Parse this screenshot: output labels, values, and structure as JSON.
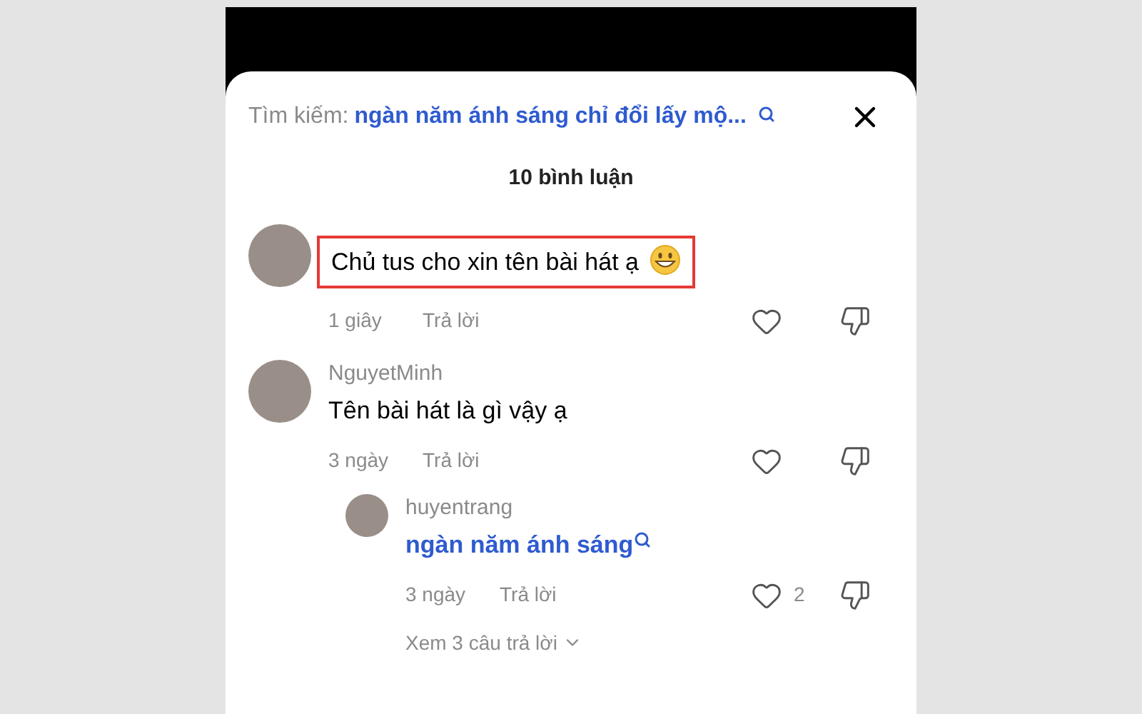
{
  "search": {
    "label": "Tìm kiếm:",
    "query": "ngàn năm ánh sáng chỉ đổi lấy mộ..."
  },
  "comment_count": "10 bình luận",
  "comments": [
    {
      "kind": "text",
      "text": "Chủ tus cho xin tên bài hát ạ",
      "emoji": true,
      "highlighted": true,
      "time": "1 giây",
      "reply_label": "Trả lời"
    },
    {
      "kind": "text",
      "author": "NguyetMinh",
      "text": "Tên bài hát là gì vậy ạ",
      "emoji": false,
      "highlighted": false,
      "time": "3 ngày",
      "reply_label": "Trả lời",
      "replies": [
        {
          "kind": "search_link",
          "author": "huyentrang",
          "text": "ngàn năm ánh sáng",
          "emoji": false,
          "highlighted": false,
          "time": "3 ngày",
          "reply_label": "Trả lời",
          "likes": "2"
        }
      ],
      "more_replies": "Xem 3 câu trả lời"
    }
  ]
}
